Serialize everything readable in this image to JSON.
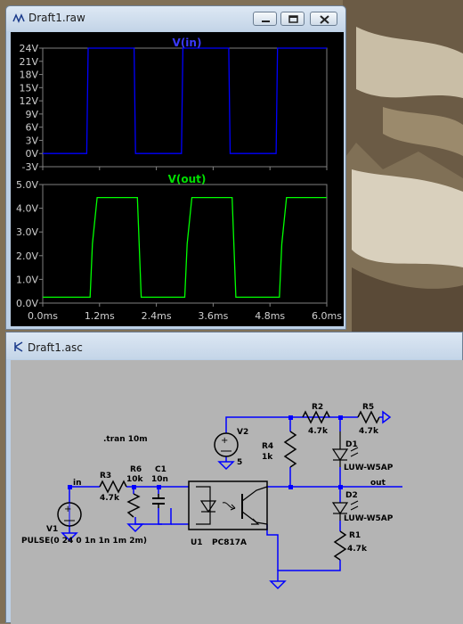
{
  "waveform_window": {
    "title": "Draft1.raw",
    "top_trace": {
      "name": "V(in)",
      "y_ticks": [
        "24V",
        "21V",
        "18V",
        "15V",
        "12V",
        "9V",
        "6V",
        "3V",
        "0V",
        "-3V"
      ]
    },
    "bottom_trace": {
      "name": "V(out)",
      "y_ticks": [
        "5.0V",
        "4.0V",
        "3.0V",
        "2.0V",
        "1.0V",
        "0.0V"
      ]
    },
    "x_ticks": [
      "0.0ms",
      "1.2ms",
      "2.4ms",
      "3.6ms",
      "4.8ms",
      "6.0ms"
    ],
    "colors": {
      "background": "#000000",
      "grid": "#808080",
      "in_trace": "#0000ff",
      "out_trace": "#00ff00",
      "in_label": "#3a3aff",
      "out_label": "#00e000"
    }
  },
  "chart_data": [
    {
      "type": "line",
      "title": "V(in)",
      "xlim": [
        0,
        6.0
      ],
      "ylim": [
        -3,
        24
      ],
      "series": [
        {
          "name": "V(in)",
          "x": [
            0,
            0.0,
            0.93,
            0.96,
            1.93,
            1.96,
            2.93,
            2.96,
            3.93,
            3.96,
            4.93,
            4.96,
            6.0
          ],
          "y": [
            0,
            0,
            0,
            24,
            24,
            0,
            0,
            24,
            24,
            0,
            0,
            24,
            24
          ]
        }
      ]
    },
    {
      "type": "line",
      "title": "V(out)",
      "xlim": [
        0,
        6.0
      ],
      "ylim": [
        0,
        5.0
      ],
      "series": [
        {
          "name": "V(out)",
          "x": [
            0,
            1.0,
            1.05,
            1.15,
            2.0,
            2.08,
            3.0,
            3.05,
            3.15,
            4.0,
            4.08,
            5.0,
            5.05,
            5.15,
            6.0
          ],
          "y": [
            0.25,
            0.25,
            2.5,
            4.45,
            4.45,
            0.25,
            0.25,
            2.5,
            4.45,
            4.45,
            0.25,
            0.25,
            2.5,
            4.45,
            4.45
          ]
        }
      ]
    }
  ],
  "schematic_window": {
    "title": "Draft1.asc",
    "directive": ".tran 10m",
    "labels": {
      "in_net": "in",
      "out_net": "out",
      "v1_name": "V1",
      "v1_value": "PULSE(0 24 0 1n 1n 1m 2m)",
      "v2_name": "V2",
      "v2_value": "5",
      "r3_name": "R3",
      "r3_value": "4.7k",
      "r6_name": "R6",
      "r6_value": "10k",
      "c1_name": "C1",
      "c1_value": "10n",
      "u1_name": "U1",
      "u1_value": "PC817A",
      "r4_name": "R4",
      "r4_value": "1k",
      "r2_name": "R2",
      "r2_value": "4.7k",
      "r5_name": "R5",
      "r5_value": "4.7k",
      "d1_name": "D1",
      "d1_value": "LUW-W5AP",
      "d2_name": "D2",
      "d2_value": "LUW-W5AP",
      "r1_name": "R1",
      "r1_value": "4.7k"
    },
    "colors": {
      "wire": "#0000ff",
      "component": "#000000",
      "canvas": "#b4b4b4",
      "junction": "#0000ff"
    }
  }
}
